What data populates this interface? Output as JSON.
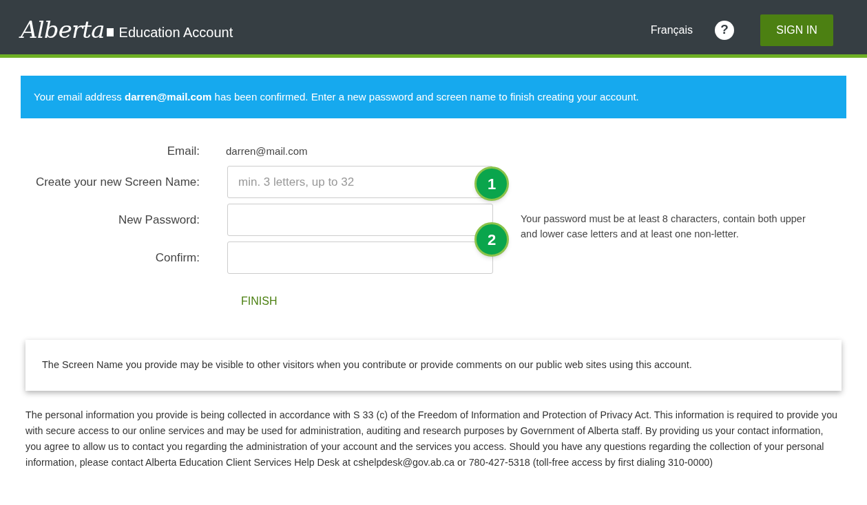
{
  "header": {
    "logo_script": "Alberta",
    "logo_text": "Education Account",
    "language_link": "Français",
    "help_icon": "?",
    "sign_in_button": "SIGN IN"
  },
  "banner": "Your email address **darren@mail.com** has been confirmed. Enter a new password and screen name to finish creating your account.",
  "email_row": {
    "label": "Email:",
    "value": "darren@mail.com"
  },
  "fields": [
    {
      "label": "Create your new Screen Name:",
      "placeholder": "min. 3 letters, up to 32"
    },
    {
      "label": "New Password:"
    },
    {
      "label": "Confirm:"
    }
  ],
  "password_hint": "Your password must be at least 8 characters, contain both upper and lower case letters and at least one non-letter.",
  "callouts": [
    "1",
    "2"
  ],
  "finish_button": "FINISH",
  "notice": "The Screen Name you provide may be visible to other visitors when you contribute or provide comments on our public web sites using this account.",
  "privacy": "The personal information you provide is being collected in accordance with S 33 (c) of the Freedom of Information and Protection of Privacy Act. This information is required to provide you with secure access to our online services and may be used for administration, auditing and research purposes by Government of Alberta staff. By providing us your contact information, you agree to allow us to contact you regarding the administration of your account and the services you access. Should you have any questions regarding the collection of your personal information, please contact Alberta Education Client Services Help Desk at cshelpdesk@gov.ab.ca or 780-427-5318 (toll-free access by first dialing 310-0000)"
}
